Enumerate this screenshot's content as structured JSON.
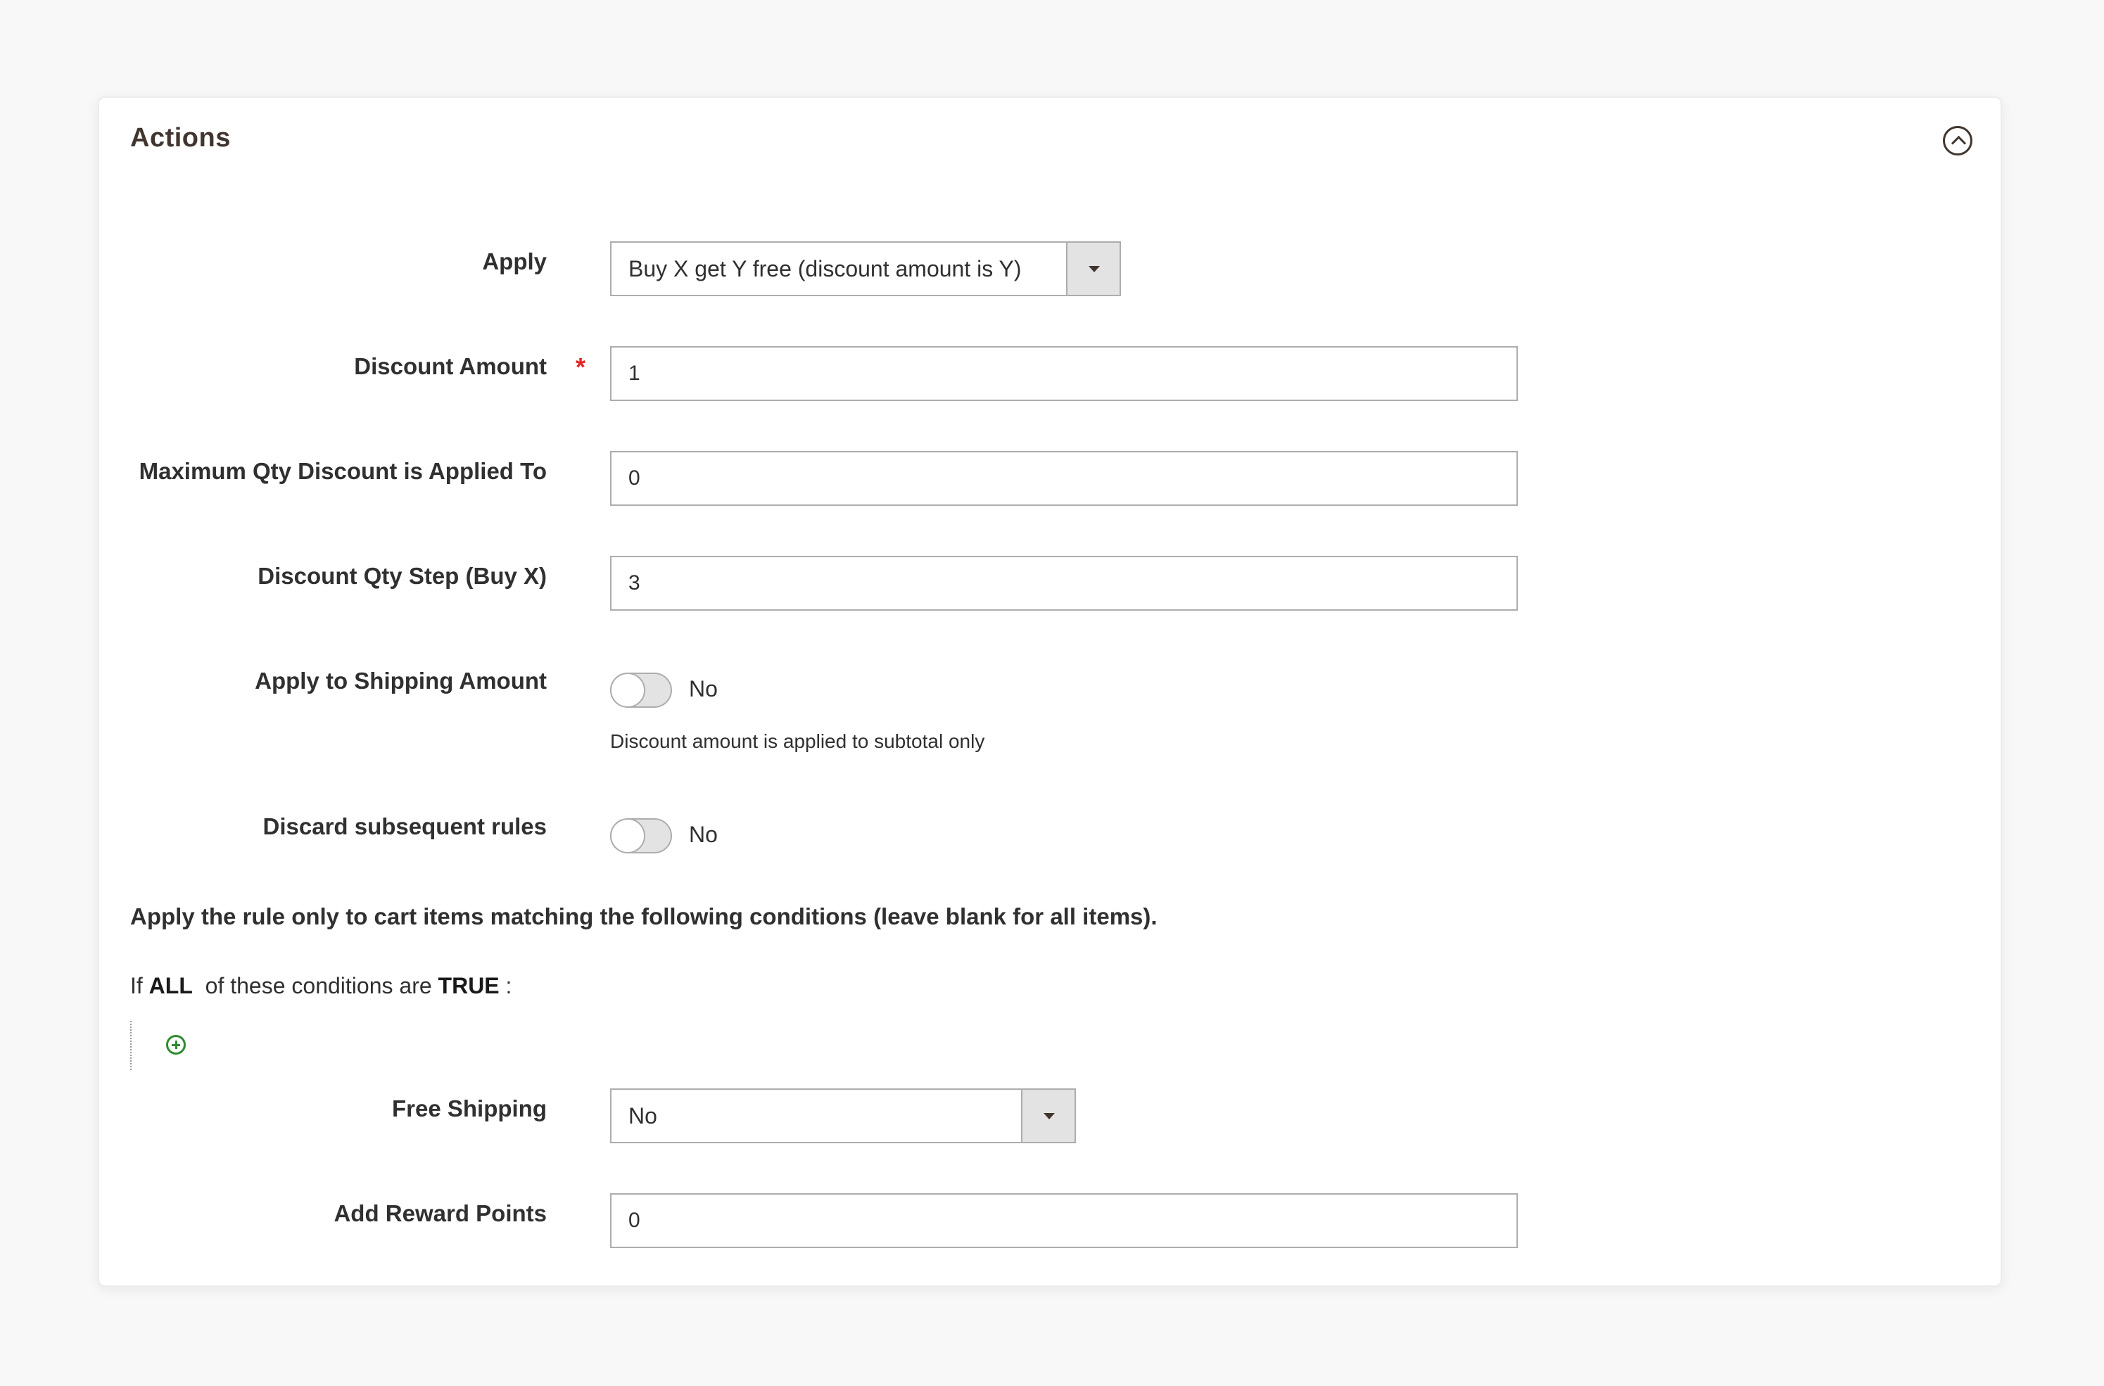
{
  "panel": {
    "title": "Actions"
  },
  "fields": {
    "apply": {
      "label": "Apply",
      "value": "Buy X get Y free (discount amount is Y)"
    },
    "discount_amount": {
      "label": "Discount Amount",
      "required_mark": "*",
      "value": "1"
    },
    "max_qty": {
      "label": "Maximum Qty Discount is Applied To",
      "value": "0"
    },
    "qty_step": {
      "label": "Discount Qty Step (Buy X)",
      "value": "3"
    },
    "apply_shipping": {
      "label": "Apply to Shipping Amount",
      "state": "No",
      "note": "Discount amount is applied to subtotal only"
    },
    "discard_rules": {
      "label": "Discard subsequent rules",
      "state": "No"
    },
    "free_shipping": {
      "label": "Free Shipping",
      "value": "No"
    },
    "reward_points": {
      "label": "Add Reward Points",
      "value": "0"
    }
  },
  "conditions": {
    "intro": "Apply the rule only to cart items matching the following conditions (leave blank for all items).",
    "prefix": "If",
    "aggregator": "ALL",
    "middle": "of these conditions are",
    "value": "TRUE",
    "suffix": ":"
  },
  "colors": {
    "required": "#e22626",
    "add_icon": "#2f8a2f"
  }
}
